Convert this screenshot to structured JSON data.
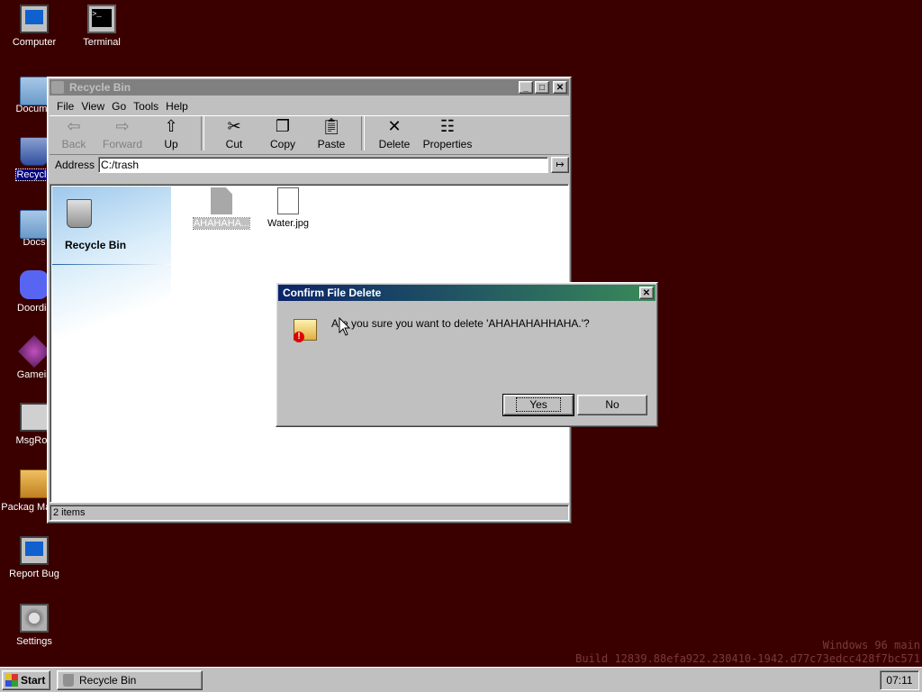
{
  "desktop": {
    "icons": [
      {
        "label": "Computer",
        "icon": "computer-icon"
      },
      {
        "label": "Terminal",
        "icon": "terminal-icon"
      },
      {
        "label": "Docume",
        "icon": "folder-icon"
      },
      {
        "label": "Recycle",
        "icon": "recycle-bin-icon"
      },
      {
        "label": "Docs",
        "icon": "folder-icon"
      },
      {
        "label": "Doordis",
        "icon": "discord-icon"
      },
      {
        "label": "Gamein",
        "icon": "game-icon"
      },
      {
        "label": "MsgRoo",
        "icon": "message-room-icon"
      },
      {
        "label": "Packag Manag",
        "icon": "package-manager-icon"
      },
      {
        "label": "Report Bug",
        "icon": "report-bug-icon"
      },
      {
        "label": "Settings",
        "icon": "settings-icon"
      }
    ]
  },
  "explorer": {
    "title": "Recycle Bin",
    "menu": [
      "File",
      "View",
      "Go",
      "Tools",
      "Help"
    ],
    "toolbar": {
      "back": "Back",
      "forward": "Forward",
      "up": "Up",
      "cut": "Cut",
      "copy": "Copy",
      "paste": "Paste",
      "delete": "Delete",
      "properties": "Properties"
    },
    "address_label": "Address",
    "address_value": "C:/trash",
    "sidebar_title": "Recycle Bin",
    "files": [
      {
        "name": "AHAHAHA...",
        "icon": "generic-file-icon",
        "selected": true
      },
      {
        "name": "Water.jpg",
        "icon": "jpeg-file-icon",
        "selected": false
      }
    ],
    "status": "2 items"
  },
  "dialog": {
    "title": "Confirm File Delete",
    "message": "Are you sure you want to delete 'AHAHAHAHHAHA.'?",
    "yes": "Yes",
    "no": "No"
  },
  "watermark": {
    "line1": "Windows 96 main",
    "line2": "Build 12839.88efa922.230410-1942.d77c73edcc428f7bc571"
  },
  "taskbar": {
    "start": "Start",
    "task": "Recycle Bin",
    "clock": "07:11"
  },
  "colors": {
    "desktop_bg": "#3a0000",
    "active_title_start": "#0a246a",
    "active_title_end": "#3a8a5a",
    "window_face": "#c0c0c0"
  }
}
